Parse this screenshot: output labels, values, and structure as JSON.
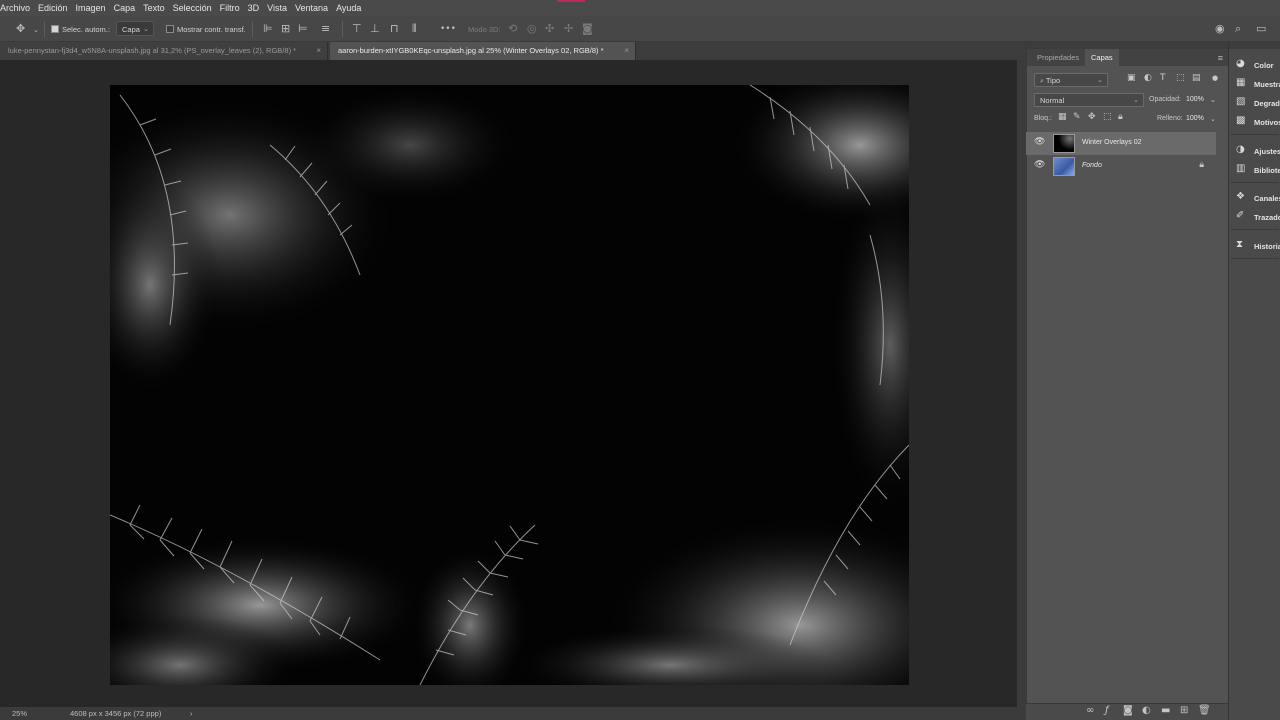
{
  "menu": [
    "Archivo",
    "Edición",
    "Imagen",
    "Capa",
    "Texto",
    "Selección",
    "Filtro",
    "3D",
    "Vista",
    "Ventana",
    "Ayuda"
  ],
  "options": {
    "auto_select_label": "Selec. autom.:",
    "auto_select_target": "Capa",
    "show_transform_label": "Mostrar contr. transf.",
    "mode3d_label": "Modo 3D:",
    "more_glyph": "•••"
  },
  "tabs": [
    {
      "title": "luke-pennystan-fj3d4_w5N8A-unsplash.jpg al 31,2% (PS_overlay_leaves (2), RGB/8) *",
      "active": false
    },
    {
      "title": "aaron-burden-xtIYGB0KEqc-unsplash.jpg al 25% (Winter Overlays 02, RGB/8) *",
      "active": true
    }
  ],
  "tab_close_glyph": "×",
  "status": {
    "zoom": "25%",
    "doc_info": "4608 px x 3456 px (72 ppp)",
    "arrow": "›"
  },
  "panel": {
    "tabs": [
      "Propiedades",
      "Capas"
    ],
    "active_tab": "Capas",
    "menu_glyph": "≡",
    "filter_kind": "Tipo",
    "blend_mode": "Normal",
    "opacity_label": "Opacidad:",
    "opacity_value": "100%",
    "lock_label": "Bloq.:",
    "fill_label": "Relleno:",
    "fill_value": "100%",
    "layers": [
      {
        "name": "Winter Overlays 02",
        "selected": true,
        "locked": false
      },
      {
        "name": "Fondo",
        "selected": false,
        "locked": true
      }
    ],
    "footer_icons": [
      "link-icon",
      "fx-icon",
      "mask-icon",
      "adjustment-icon",
      "folder-icon",
      "new-layer-icon",
      "trash-icon"
    ]
  },
  "dock": [
    {
      "label": "Color",
      "icon": "color-wheel-icon"
    },
    {
      "label": "Muestras",
      "icon": "swatches-icon"
    },
    {
      "label": "Degradados",
      "icon": "gradient-icon"
    },
    {
      "label": "Motivos",
      "icon": "patterns-icon"
    },
    {
      "label": "Ajustes",
      "icon": "adjustments-icon"
    },
    {
      "label": "Bibliotecas",
      "icon": "libraries-icon"
    },
    {
      "label": "Canales",
      "icon": "channels-icon"
    },
    {
      "label": "Trazados",
      "icon": "paths-icon"
    },
    {
      "label": "Historia",
      "icon": "history-icon"
    }
  ],
  "colors": {
    "accent_mark": "#c2255c",
    "canvas": "#030303",
    "workspace": "#282828",
    "panel": "#535353"
  }
}
